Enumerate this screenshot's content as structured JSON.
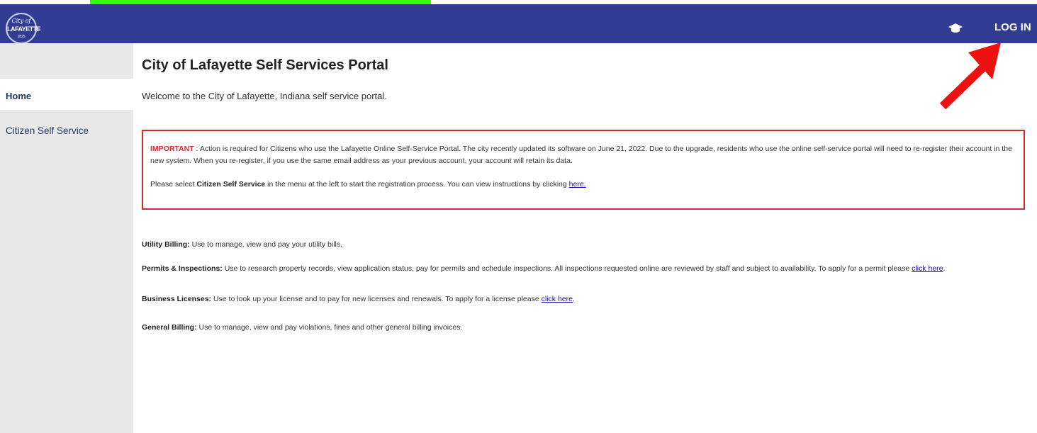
{
  "header": {
    "logo_top": "City of",
    "logo_main": "LAFAYETTE",
    "logo_bottom": "1825",
    "login_label": "LOG IN",
    "bar_color": "#333c93"
  },
  "sidebar": {
    "items": [
      {
        "label": "Home",
        "selected": true
      },
      {
        "label": "Citizen Self Service",
        "selected": false
      }
    ]
  },
  "main": {
    "title": "City of Lafayette Self Services Portal",
    "welcome": "Welcome to the City of Lafayette, Indiana self service portal.",
    "important": {
      "label": "IMPORTANT",
      "text": " : Action is required for Citizens who use the Lafayette Online Self-Service Portal. The city recently updated its software on June 21, 2022. Due to the upgrade, residents who use the online self-service portal will need to re-register their account in the new system. When you re-register, if you use the same email address as your previous account, your account will retain its data.",
      "p2_prefix": "Please select ",
      "p2_bold": "Citizen Self Service",
      "p2_suffix": " in the menu at the left to start the registration process. You can view instructions by clicking ",
      "p2_link": "here."
    },
    "services": [
      {
        "name": "Utility Billing:",
        "text": " Use to manage, view and pay your utility bills.",
        "link": ""
      },
      {
        "name": "Permits & Inspections:",
        "text": " Use to research property records, view application status, pay for permits and schedule inspections. All inspections requested online are reviewed by staff and subject to availability. To apply for a permit please ",
        "link": "click here",
        "after": "."
      },
      {
        "name": "Business Licenses:",
        "text": " Use to look up your license and to pay for new licenses and renewals. To apply for a license please ",
        "link": "click here",
        "after": "."
      },
      {
        "name": "General Billing:",
        "text": " Use to manage, view and pay violations, fines and other general billing invoices.",
        "link": ""
      }
    ]
  },
  "icons": {
    "cap": "graduation-cap-icon",
    "arrow": "red-arrow-annotation"
  },
  "colors": {
    "accent": "#333c93",
    "important_border": "#d62a2a",
    "link": "#1a0dab",
    "highlight_strip": "#33ff00"
  }
}
